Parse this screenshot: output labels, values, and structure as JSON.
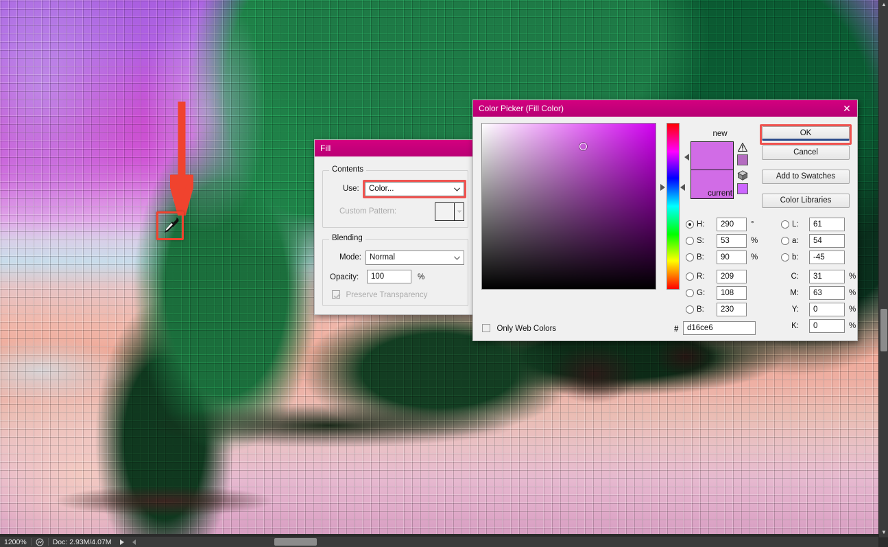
{
  "app": {
    "zoom_level": "1200%",
    "doc_info": "Doc: 2.93M/4.07M"
  },
  "fill_dialog": {
    "title": "Fill",
    "contents_legend": "Contents",
    "use_label": "Use:",
    "use_value": "Color...",
    "custom_pattern_label": "Custom Pattern:",
    "blending_legend": "Blending",
    "mode_label": "Mode:",
    "mode_value": "Normal",
    "opacity_label": "Opacity:",
    "opacity_value": "100",
    "opacity_unit": "%",
    "preserve_transparency_label": "Preserve Transparency",
    "preserve_transparency_checked": true
  },
  "color_picker": {
    "title": "Color Picker (Fill Color)",
    "close_glyph": "✕",
    "new_label": "new",
    "current_label": "current",
    "only_web_colors_label": "Only Web Colors",
    "only_web_colors_checked": false,
    "hex_symbol": "#",
    "hex_value": "d16ce6",
    "new_color": "#d16ce6",
    "current_color": "#d16ce6",
    "gamut_alt_color": "#b46cc0",
    "websafe_alt_color": "#cc66ff",
    "buttons": [
      {
        "label": "OK",
        "highlighted": true
      },
      {
        "label": "Cancel",
        "highlighted": false
      },
      {
        "label": "Add to Swatches",
        "highlighted": false
      },
      {
        "label": "Color Libraries",
        "highlighted": false
      }
    ],
    "hsb": [
      {
        "key": "H",
        "label": "H:",
        "value": "290",
        "unit": "°",
        "selected": true
      },
      {
        "key": "S",
        "label": "S:",
        "value": "53",
        "unit": "%",
        "selected": false
      },
      {
        "key": "B",
        "label": "B:",
        "value": "90",
        "unit": "%",
        "selected": false
      }
    ],
    "rgb": [
      {
        "key": "R",
        "label": "R:",
        "value": "209",
        "unit": "",
        "selected": false
      },
      {
        "key": "G",
        "label": "G:",
        "value": "108",
        "unit": "",
        "selected": false
      },
      {
        "key": "B2",
        "label": "B:",
        "value": "230",
        "unit": "",
        "selected": false
      }
    ],
    "lab": [
      {
        "key": "L",
        "label": "L:",
        "value": "61",
        "unit": "",
        "selected": false
      },
      {
        "key": "a",
        "label": "a:",
        "value": "54",
        "unit": "",
        "selected": false
      },
      {
        "key": "b",
        "label": "b:",
        "value": "-45",
        "unit": "",
        "selected": false
      }
    ],
    "cmyk": [
      {
        "key": "C",
        "label": "C:",
        "value": "31",
        "unit": "%"
      },
      {
        "key": "M",
        "label": "M:",
        "value": "63",
        "unit": "%"
      },
      {
        "key": "Y",
        "label": "Y:",
        "value": "0",
        "unit": "%"
      },
      {
        "key": "K",
        "label": "K:",
        "value": "0",
        "unit": "%"
      }
    ]
  },
  "annotation": {
    "arrow_color": "#f0432e",
    "box_color": "#f0432e",
    "tool": "eyedropper"
  }
}
